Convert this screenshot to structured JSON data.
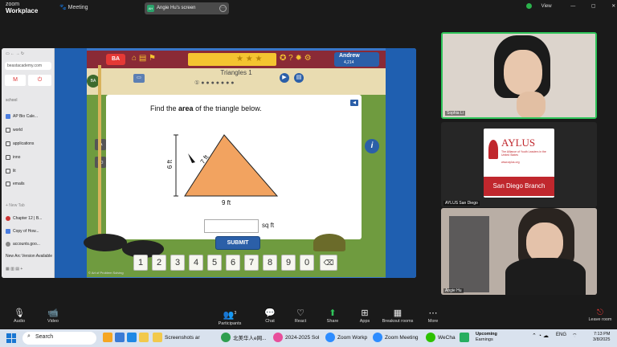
{
  "zoom": {
    "brand_top": "zoom",
    "brand_bottom": "Workplace",
    "meeting_label": "Meeting",
    "share_label": "Angie Hu's screen",
    "share_initials": "AH",
    "view_label": "View"
  },
  "browser": {
    "url": "beastacademy.com",
    "section": "school",
    "items": [
      "AP Bio Cale...",
      "world",
      "applications",
      "inno",
      "lit",
      "emails"
    ],
    "new_tab": "+ New Tab",
    "tabs": [
      "Chapter 12 | B...",
      "Copy of How...",
      "accounts.goo..."
    ],
    "footer": "New Arc Version Available"
  },
  "game": {
    "player_name": "Andrew",
    "player_score": "4,214",
    "lesson_title": "Triangles 1",
    "question_pre": "Find the ",
    "question_bold": "area",
    "question_post": " of the triangle below.",
    "height_label": "6 ft",
    "slant_label": "7 ft",
    "base_label": "9 ft",
    "answer_value": "",
    "unit_label": "sq ft",
    "submit_label": "SUBMIT",
    "keys": [
      "1",
      "2",
      "3",
      "4",
      "5",
      "6",
      "7",
      "8",
      "9",
      "0"
    ],
    "copyright": "© Art of Problem Solving",
    "colors": {
      "triangle": "#f2a360",
      "game_top": "#8a2a36",
      "submit": "#2b5fa8"
    }
  },
  "participants": [
    {
      "name": "Sophia Li"
    },
    {
      "name": "AYLUS San Diego",
      "logo_title": "AYLUS",
      "logo_sub": "The Alliance of Youth Leaders in the United States",
      "logo_url": "www.aylus.org",
      "branch": "San Diego Branch"
    },
    {
      "name": "Angie Hu"
    }
  ],
  "toolbar": {
    "audio": "Audio",
    "video": "Video",
    "participants_count": "3",
    "participants": "Participants",
    "chat": "Chat",
    "react": "React",
    "share": "Share",
    "apps": "Apps",
    "breakout": "Breakout rooms",
    "more": "More",
    "leave": "Leave room"
  },
  "taskbar": {
    "search": "Search",
    "apps": [
      "Screenshots ar",
      "北美华人e网...",
      "2024-2025 Sol",
      "Zoom Workp",
      "Zoom Meeting",
      "WeCha"
    ],
    "upcoming_title": "Upcoming",
    "upcoming_sub": "Earnings",
    "lang": "ENG",
    "time": "7:13 PM",
    "date": "3/8/2025"
  }
}
